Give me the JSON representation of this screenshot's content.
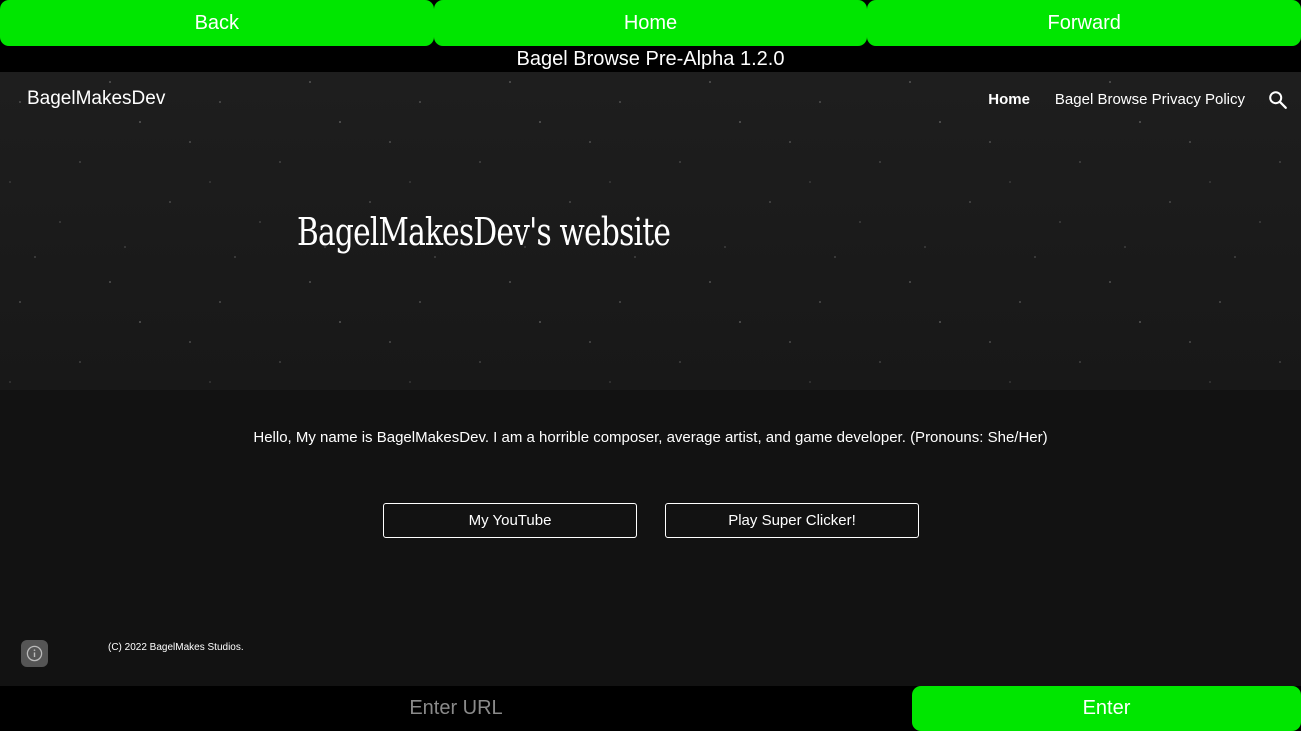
{
  "browser": {
    "back_label": "Back",
    "home_label": "Home",
    "forward_label": "Forward",
    "title": "Bagel Browse Pre-Alpha 1.2.0",
    "url_placeholder": "Enter URL",
    "enter_label": "Enter",
    "accent_color": "#00e600"
  },
  "site": {
    "brand": "BagelMakesDev",
    "nav": [
      {
        "label": "Home",
        "active": true
      },
      {
        "label": "Bagel Browse Privacy Policy",
        "active": false
      }
    ],
    "search_icon": "search-icon",
    "hero_title": "BagelMakesDev's website",
    "intro": "Hello, My name is BagelMakesDev. I am a horrible composer, average artist, and game developer. (Pronouns: She/Her)",
    "buttons": [
      {
        "label": "My YouTube"
      },
      {
        "label": "Play Super Clicker!"
      }
    ],
    "info_icon": "info-icon",
    "footer": "(C) 2022 BagelMakes Studios."
  }
}
